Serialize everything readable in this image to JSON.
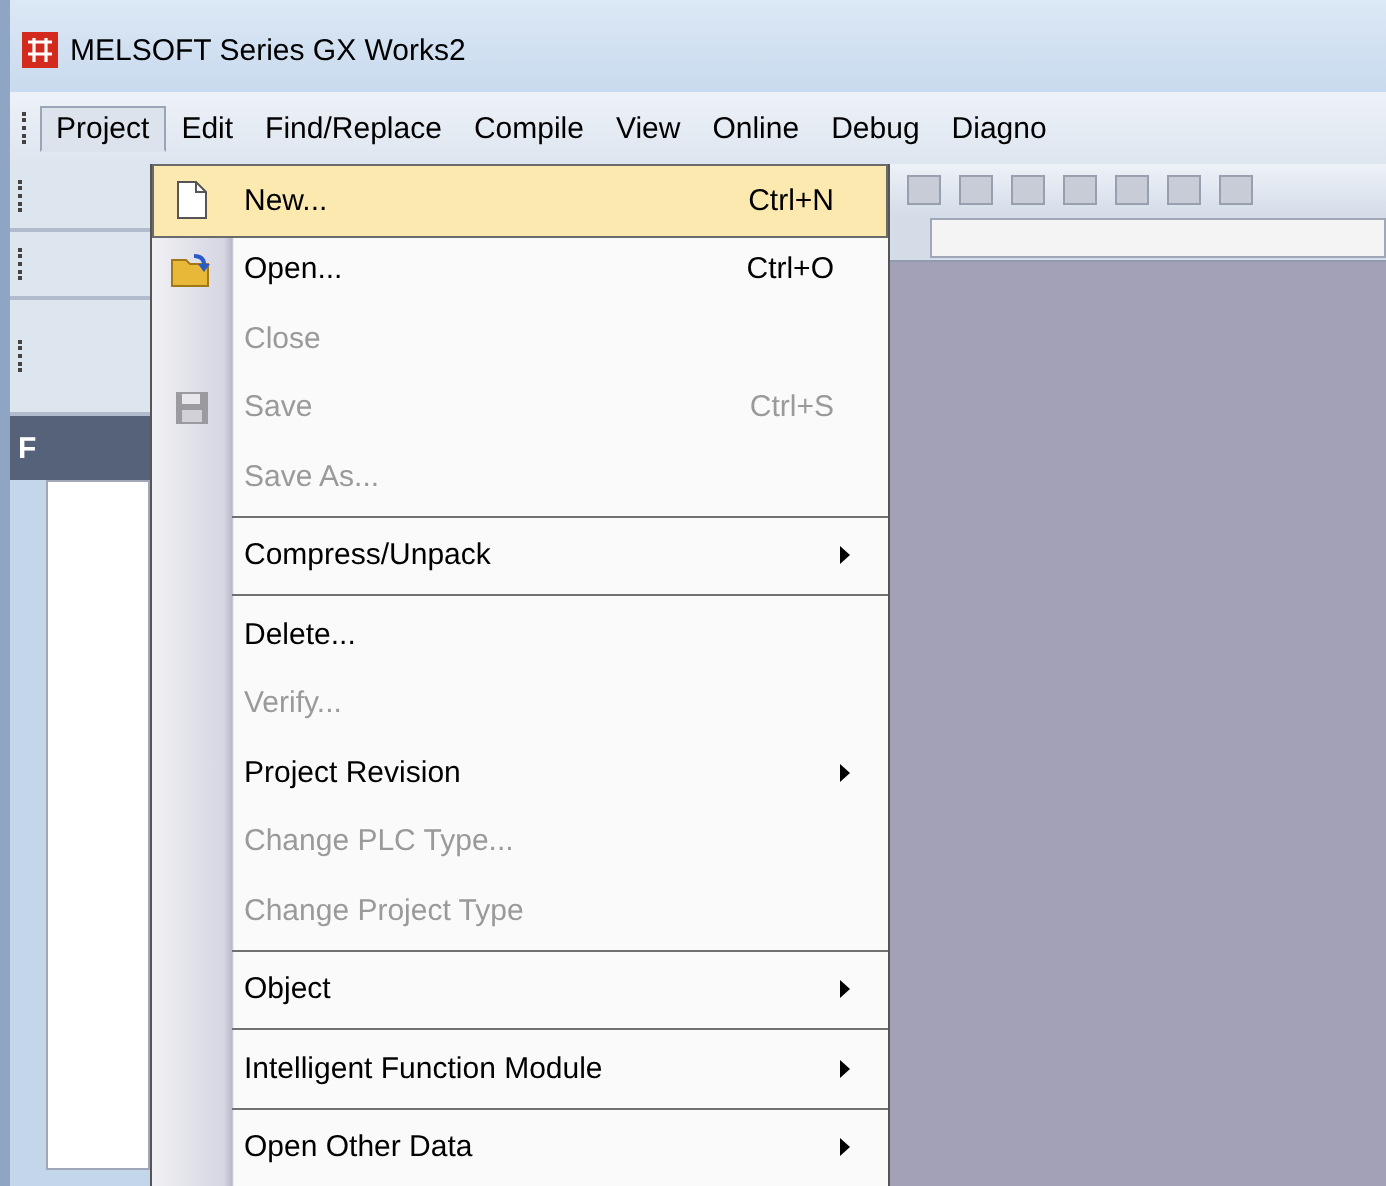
{
  "window": {
    "title": "MELSOFT Series GX Works2"
  },
  "menubar": [
    {
      "label": "Project",
      "selected": true
    },
    {
      "label": "Edit",
      "selected": false
    },
    {
      "label": "Find/Replace",
      "selected": false
    },
    {
      "label": "Compile",
      "selected": false
    },
    {
      "label": "View",
      "selected": false
    },
    {
      "label": "Online",
      "selected": false
    },
    {
      "label": "Debug",
      "selected": false
    },
    {
      "label": "Diagno",
      "selected": false
    }
  ],
  "side_panel": {
    "tab": "F"
  },
  "menu": [
    {
      "kind": "item",
      "label": "New...",
      "shortcut": "Ctrl+N",
      "disabled": false,
      "selected": true,
      "submenu": false
    },
    {
      "kind": "item",
      "label": "Open...",
      "shortcut": "Ctrl+O",
      "disabled": false,
      "selected": false,
      "submenu": false
    },
    {
      "kind": "item",
      "label": "Close",
      "disabled": true,
      "selected": false,
      "submenu": false
    },
    {
      "kind": "item",
      "label": "Save",
      "shortcut": "Ctrl+S",
      "disabled": true,
      "selected": false,
      "submenu": false
    },
    {
      "kind": "item",
      "label": "Save As...",
      "disabled": true,
      "selected": false,
      "submenu": false
    },
    {
      "kind": "separator"
    },
    {
      "kind": "item",
      "label": "Compress/Unpack",
      "disabled": false,
      "selected": false,
      "submenu": true
    },
    {
      "kind": "separator"
    },
    {
      "kind": "item",
      "label": "Delete...",
      "disabled": false,
      "selected": false,
      "submenu": false
    },
    {
      "kind": "item",
      "label": "Verify...",
      "disabled": true,
      "selected": false,
      "submenu": false
    },
    {
      "kind": "item",
      "label": "Project Revision",
      "disabled": false,
      "selected": false,
      "submenu": true
    },
    {
      "kind": "item",
      "label": "Change PLC Type...",
      "disabled": true,
      "selected": false,
      "submenu": false
    },
    {
      "kind": "item",
      "label": "Change Project Type",
      "disabled": true,
      "selected": false,
      "submenu": false
    },
    {
      "kind": "separator"
    },
    {
      "kind": "item",
      "label": "Object",
      "disabled": false,
      "selected": false,
      "submenu": true
    },
    {
      "kind": "separator"
    },
    {
      "kind": "item",
      "label": "Intelligent Function Module",
      "disabled": false,
      "selected": false,
      "submenu": true
    },
    {
      "kind": "separator"
    },
    {
      "kind": "item",
      "label": "Open Other Data",
      "disabled": false,
      "selected": false,
      "submenu": true
    }
  ]
}
